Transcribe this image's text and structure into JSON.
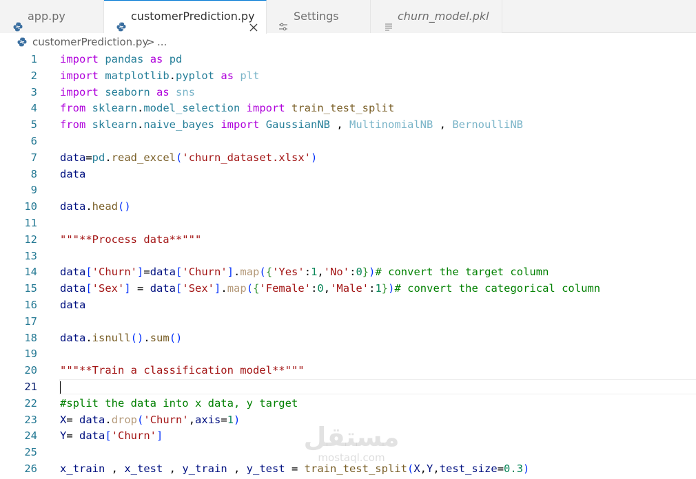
{
  "tabs": [
    {
      "label": "app.py",
      "icon": "python-icon",
      "active": false,
      "italic": false
    },
    {
      "label": "customerPrediction.py",
      "icon": "python-icon",
      "active": true,
      "italic": false,
      "close": "close-icon"
    },
    {
      "label": "Settings",
      "icon": "settings-sliders-icon",
      "active": false,
      "italic": false
    },
    {
      "label": "churn_model.pkl",
      "icon": "file-lines-icon",
      "active": false,
      "italic": true
    }
  ],
  "breadcrumb": {
    "file": "customerPrediction.py",
    "separator": ">",
    "more": "..."
  },
  "editor": {
    "current_line": 21,
    "lines": [
      {
        "n": "1",
        "tokens": [
          [
            "kw",
            "import"
          ],
          [
            "pl",
            " "
          ],
          [
            "mod",
            "pandas"
          ],
          [
            "pl",
            " "
          ],
          [
            "kw",
            "as"
          ],
          [
            "pl",
            " "
          ],
          [
            "mod",
            "pd"
          ]
        ]
      },
      {
        "n": "2",
        "tokens": [
          [
            "kw",
            "import"
          ],
          [
            "pl",
            " "
          ],
          [
            "mod",
            "matplotlib"
          ],
          [
            "pl",
            "."
          ],
          [
            "mod",
            "pyplot"
          ],
          [
            "pl",
            " "
          ],
          [
            "kw",
            "as"
          ],
          [
            "pl",
            " "
          ],
          [
            "dim",
            "plt"
          ]
        ]
      },
      {
        "n": "3",
        "tokens": [
          [
            "kw",
            "import"
          ],
          [
            "pl",
            " "
          ],
          [
            "mod",
            "seaborn"
          ],
          [
            "pl",
            " "
          ],
          [
            "kw",
            "as"
          ],
          [
            "pl",
            " "
          ],
          [
            "dim",
            "sns"
          ]
        ]
      },
      {
        "n": "4",
        "tokens": [
          [
            "kw",
            "from"
          ],
          [
            "pl",
            " "
          ],
          [
            "mod",
            "sklearn"
          ],
          [
            "pl",
            "."
          ],
          [
            "mod",
            "model_selection"
          ],
          [
            "pl",
            " "
          ],
          [
            "kw",
            "import"
          ],
          [
            "pl",
            " "
          ],
          [
            "fn",
            "train_test_split"
          ]
        ]
      },
      {
        "n": "5",
        "tokens": [
          [
            "kw",
            "from"
          ],
          [
            "pl",
            " "
          ],
          [
            "mod",
            "sklearn"
          ],
          [
            "pl",
            "."
          ],
          [
            "mod",
            "naive_bayes"
          ],
          [
            "pl",
            " "
          ],
          [
            "kw",
            "import"
          ],
          [
            "pl",
            " "
          ],
          [
            "mod",
            "GaussianNB"
          ],
          [
            "pl",
            " , "
          ],
          [
            "dim",
            "MultinomialNB"
          ],
          [
            "pl",
            " , "
          ],
          [
            "dim",
            "BernoulliNB"
          ]
        ]
      },
      {
        "n": "6",
        "tokens": []
      },
      {
        "n": "7",
        "tokens": [
          [
            "var",
            "data"
          ],
          [
            "pl",
            "="
          ],
          [
            "mod",
            "pd"
          ],
          [
            "pl",
            "."
          ],
          [
            "fn",
            "read_excel"
          ],
          [
            "p1",
            "("
          ],
          [
            "str",
            "'churn_dataset.xlsx'"
          ],
          [
            "p1",
            ")"
          ]
        ]
      },
      {
        "n": "8",
        "tokens": [
          [
            "var",
            "data"
          ]
        ]
      },
      {
        "n": "9",
        "tokens": []
      },
      {
        "n": "10",
        "tokens": [
          [
            "var",
            "data"
          ],
          [
            "pl",
            "."
          ],
          [
            "fn",
            "head"
          ],
          [
            "p1",
            "()"
          ]
        ]
      },
      {
        "n": "11",
        "tokens": []
      },
      {
        "n": "12",
        "tokens": [
          [
            "str",
            "\"\"\"**Process data**\"\"\""
          ]
        ]
      },
      {
        "n": "13",
        "tokens": []
      },
      {
        "n": "14",
        "tokens": [
          [
            "var",
            "data"
          ],
          [
            "p1",
            "["
          ],
          [
            "str",
            "'Churn'"
          ],
          [
            "p1",
            "]"
          ],
          [
            "pl",
            "="
          ],
          [
            "var",
            "data"
          ],
          [
            "p1",
            "["
          ],
          [
            "str",
            "'Churn'"
          ],
          [
            "p1",
            "]"
          ],
          [
            "pl",
            "."
          ],
          [
            "dimfn",
            "map"
          ],
          [
            "p1",
            "("
          ],
          [
            "p2",
            "{"
          ],
          [
            "str",
            "'Yes'"
          ],
          [
            "pl",
            ":"
          ],
          [
            "num",
            "1"
          ],
          [
            "pl",
            ","
          ],
          [
            "str",
            "'No'"
          ],
          [
            "pl",
            ":"
          ],
          [
            "num",
            "0"
          ],
          [
            "p2",
            "}"
          ],
          [
            "p1",
            ")"
          ],
          [
            "com",
            "# convert the target column"
          ]
        ]
      },
      {
        "n": "15",
        "tokens": [
          [
            "var",
            "data"
          ],
          [
            "p1",
            "["
          ],
          [
            "str",
            "'Sex'"
          ],
          [
            "p1",
            "]"
          ],
          [
            "pl",
            " = "
          ],
          [
            "var",
            "data"
          ],
          [
            "p1",
            "["
          ],
          [
            "str",
            "'Sex'"
          ],
          [
            "p1",
            "]"
          ],
          [
            "pl",
            "."
          ],
          [
            "dimfn",
            "map"
          ],
          [
            "p1",
            "("
          ],
          [
            "p2",
            "{"
          ],
          [
            "str",
            "'Female'"
          ],
          [
            "pl",
            ":"
          ],
          [
            "num",
            "0"
          ],
          [
            "pl",
            ","
          ],
          [
            "str",
            "'Male'"
          ],
          [
            "pl",
            ":"
          ],
          [
            "num",
            "1"
          ],
          [
            "p2",
            "}"
          ],
          [
            "p1",
            ")"
          ],
          [
            "com",
            "# convert the categorical column"
          ]
        ]
      },
      {
        "n": "16",
        "tokens": [
          [
            "var",
            "data"
          ]
        ]
      },
      {
        "n": "17",
        "tokens": []
      },
      {
        "n": "18",
        "tokens": [
          [
            "var",
            "data"
          ],
          [
            "pl",
            "."
          ],
          [
            "fn",
            "isnull"
          ],
          [
            "p1",
            "()"
          ],
          [
            "pl",
            "."
          ],
          [
            "fn",
            "sum"
          ],
          [
            "p1",
            "()"
          ]
        ]
      },
      {
        "n": "19",
        "tokens": []
      },
      {
        "n": "20",
        "tokens": [
          [
            "str",
            "\"\"\"**Train a classification model**\"\"\""
          ]
        ]
      },
      {
        "n": "21",
        "tokens": []
      },
      {
        "n": "22",
        "tokens": [
          [
            "com",
            "#split the data into x data, y target"
          ]
        ]
      },
      {
        "n": "23",
        "tokens": [
          [
            "var",
            "X"
          ],
          [
            "pl",
            "= "
          ],
          [
            "var",
            "data"
          ],
          [
            "pl",
            "."
          ],
          [
            "dimfn",
            "drop"
          ],
          [
            "p1",
            "("
          ],
          [
            "str",
            "'Churn'"
          ],
          [
            "pl",
            ","
          ],
          [
            "var",
            "axis"
          ],
          [
            "pl",
            "="
          ],
          [
            "num",
            "1"
          ],
          [
            "p1",
            ")"
          ]
        ]
      },
      {
        "n": "24",
        "tokens": [
          [
            "var",
            "Y"
          ],
          [
            "pl",
            "= "
          ],
          [
            "var",
            "data"
          ],
          [
            "p1",
            "["
          ],
          [
            "str",
            "'Churn'"
          ],
          [
            "p1",
            "]"
          ]
        ]
      },
      {
        "n": "25",
        "tokens": []
      },
      {
        "n": "26",
        "tokens": [
          [
            "var",
            "x_train"
          ],
          [
            "pl",
            " , "
          ],
          [
            "var",
            "x_test"
          ],
          [
            "pl",
            " , "
          ],
          [
            "var",
            "y_train"
          ],
          [
            "pl",
            " , "
          ],
          [
            "var",
            "y_test"
          ],
          [
            "pl",
            " = "
          ],
          [
            "fn",
            "train_test_split"
          ],
          [
            "p1",
            "("
          ],
          [
            "var",
            "X"
          ],
          [
            "pl",
            ","
          ],
          [
            "var",
            "Y"
          ],
          [
            "pl",
            ","
          ],
          [
            "var",
            "test_size"
          ],
          [
            "pl",
            "="
          ],
          [
            "num",
            "0.3"
          ],
          [
            "p1",
            ")"
          ]
        ]
      }
    ]
  },
  "watermark": {
    "arabic": "مستقل",
    "latin": "mostaql.com"
  },
  "colors": {
    "tab_active_border": "#0078d4",
    "line_number": "#237893",
    "keyword": "#af00db",
    "module": "#267f99",
    "variable": "#001080",
    "function": "#795e26",
    "string": "#a31515",
    "number": "#098658",
    "comment": "#008000"
  }
}
